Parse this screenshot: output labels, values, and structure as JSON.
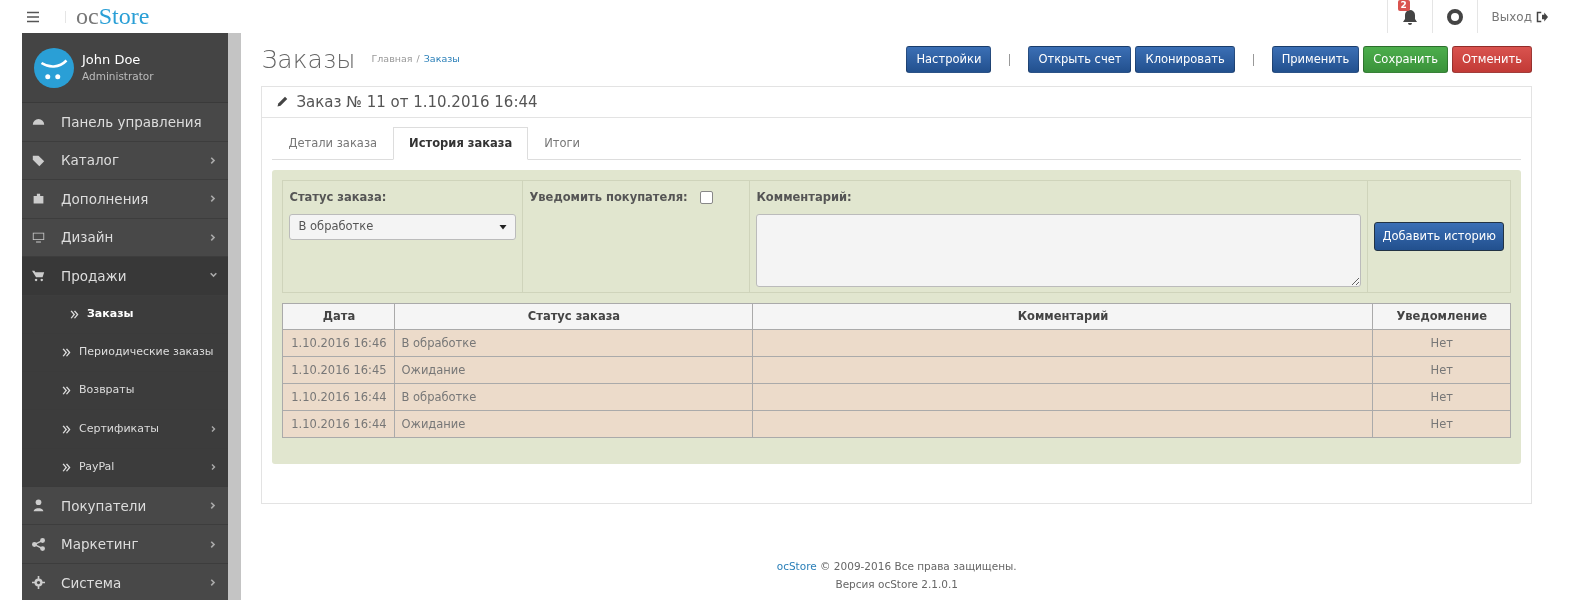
{
  "header": {
    "logo": {
      "part_1": "oc",
      "part_2": "Store"
    },
    "notifications_count": "2",
    "logout": "Выход"
  },
  "sidebar": {
    "user": {
      "name": "John Doe",
      "role": "Administrator"
    },
    "items": [
      {
        "label": "Панель управления"
      },
      {
        "label": "Каталог",
        "expanded": false
      },
      {
        "label": "Дополнения",
        "expanded": false
      },
      {
        "label": "Дизайн",
        "expanded": false
      },
      {
        "label": "Продажи",
        "expanded": true,
        "children": [
          {
            "label": "Заказы",
            "selected": true
          },
          {
            "label": "Периодические заказы",
            "selected": false
          },
          {
            "label": "Возвраты",
            "selected": false
          },
          {
            "label": "Сертификаты",
            "selected": false,
            "expanded": false
          },
          {
            "label": "PayPal",
            "selected": false,
            "expanded": false
          }
        ]
      },
      {
        "label": "Покупатели",
        "expanded": false
      },
      {
        "label": "Маркетинг",
        "expanded": false
      },
      {
        "label": "Система",
        "expanded": false
      }
    ]
  },
  "page": {
    "title": "Заказы",
    "breadcrumbs": [
      "Главная",
      "Заказы"
    ],
    "breadcrumb_separator": "/",
    "toolbar": [
      [
        {
          "label": "Настройки",
          "kind": "primary"
        }
      ],
      [
        {
          "label": "Открыть счет",
          "kind": "primary"
        },
        {
          "label": "Клонировать",
          "kind": "primary"
        }
      ],
      [
        {
          "label": "Применить",
          "kind": "primary"
        },
        {
          "label": "Сохранить",
          "kind": "success"
        },
        {
          "label": "Отменить",
          "kind": "danger"
        }
      ]
    ]
  },
  "panel": {
    "title": "Заказ № 11 от 1.10.2016 16:44",
    "tabs": [
      {
        "label": "Детали заказа",
        "selected": false
      },
      {
        "label": "История заказа",
        "selected": true
      },
      {
        "label": "Итоги",
        "selected": false
      }
    ],
    "form": {
      "status_label": "Статус заказа:",
      "status_value": "В обработке",
      "notify_label": "Уведомить покупателя:",
      "notify_checked": false,
      "comment_label": "Комментарий:",
      "add_button": "Добавить историю"
    },
    "table": {
      "columns": [
        "Дата",
        "Статус заказа",
        "Комментарий",
        "Уведомление"
      ],
      "rows": [
        [
          "1.10.2016 16:46",
          "В обработке",
          "",
          "Нет"
        ],
        [
          "1.10.2016 16:45",
          "Ожидание",
          "",
          "Нет"
        ],
        [
          "1.10.2016 16:44",
          "В обработке",
          "",
          "Нет"
        ],
        [
          "1.10.2016 16:44",
          "Ожидание",
          "",
          "Нет"
        ]
      ]
    }
  },
  "footer": {
    "link": "ocStore",
    "copyright": " © 2009-2016 Все права защищены.",
    "version": "Версия ocStore 2.1.0.1"
  }
}
